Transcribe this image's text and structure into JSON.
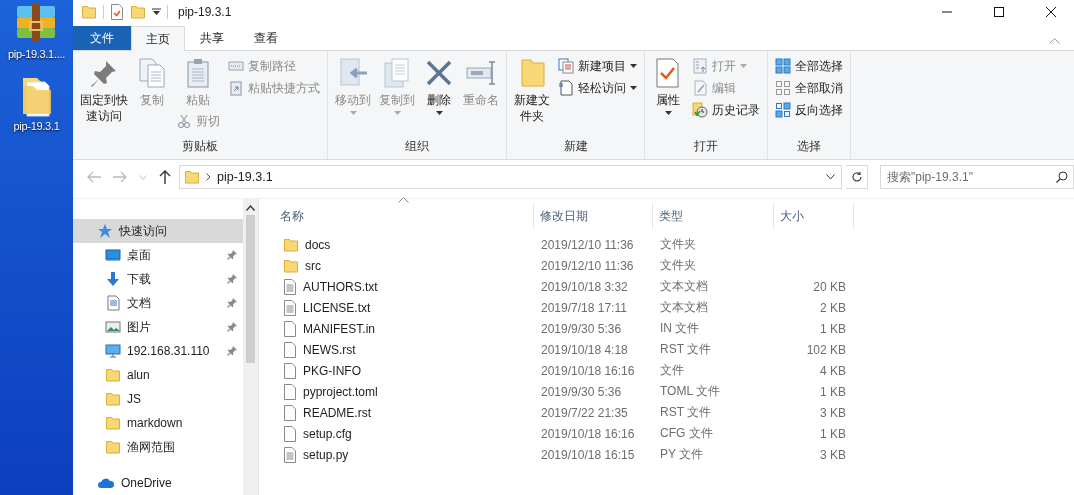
{
  "desktop": {
    "icons": [
      {
        "kind": "archive",
        "label": "pip-19.3.1...."
      },
      {
        "kind": "folder",
        "label": "pip-19.3.1"
      }
    ]
  },
  "window": {
    "title": "pip-19.3.1"
  },
  "ribbon": {
    "tabs": [
      {
        "label": "文件",
        "kind": "file",
        "selected": false
      },
      {
        "label": "主页",
        "kind": "tab",
        "selected": true
      },
      {
        "label": "共享",
        "kind": "tab",
        "selected": false
      },
      {
        "label": "查看",
        "kind": "tab",
        "selected": false
      }
    ],
    "groups": [
      {
        "label": "剪贴板",
        "columns": [
          [
            {
              "kind": "large",
              "label": "固定到快速访问",
              "disabled": false,
              "dropdown": false
            }
          ],
          [
            {
              "kind": "large",
              "label": "复制",
              "disabled": true,
              "dropdown": false
            }
          ],
          [
            {
              "kind": "large",
              "label": "粘贴",
              "disabled": true,
              "dropdown": false
            },
            {
              "kind": "small",
              "label": "剪切",
              "disabled": true,
              "dropdown": false
            }
          ],
          [
            {
              "kind": "small",
              "label": "复制路径",
              "disabled": true,
              "dropdown": false
            },
            {
              "kind": "small",
              "label": "粘贴快捷方式",
              "disabled": true,
              "dropdown": false
            }
          ]
        ]
      },
      {
        "label": "组织",
        "columns": [
          [
            {
              "kind": "large",
              "label": "移动到",
              "disabled": true,
              "dropdown": true
            }
          ],
          [
            {
              "kind": "large",
              "label": "复制到",
              "disabled": true,
              "dropdown": true
            }
          ],
          [
            {
              "kind": "large",
              "label": "删除",
              "disabled": false,
              "dropdown": true
            }
          ],
          [
            {
              "kind": "large",
              "label": "重命名",
              "disabled": true,
              "dropdown": false
            }
          ]
        ]
      },
      {
        "label": "新建",
        "columns": [
          [
            {
              "kind": "large",
              "label": "新建文件夹",
              "disabled": false,
              "dropdown": false
            }
          ],
          [
            {
              "kind": "small",
              "label": "新建项目",
              "disabled": false,
              "dropdown": true
            },
            {
              "kind": "small",
              "label": "轻松访问",
              "disabled": false,
              "dropdown": true
            }
          ]
        ]
      },
      {
        "label": "打开",
        "columns": [
          [
            {
              "kind": "large",
              "label": "属性",
              "disabled": false,
              "dropdown": true
            }
          ],
          [
            {
              "kind": "small",
              "label": "打开",
              "disabled": true,
              "dropdown": true
            },
            {
              "kind": "small",
              "label": "编辑",
              "disabled": true,
              "dropdown": false
            },
            {
              "kind": "small",
              "label": "历史记录",
              "disabled": false,
              "dropdown": false
            }
          ]
        ]
      },
      {
        "label": "选择",
        "columns": [
          [
            {
              "kind": "small",
              "label": "全部选择",
              "disabled": false,
              "dropdown": false
            },
            {
              "kind": "small",
              "label": "全部取消",
              "disabled": false,
              "dropdown": false
            },
            {
              "kind": "small",
              "label": "反向选择",
              "disabled": false,
              "dropdown": false
            }
          ]
        ]
      }
    ]
  },
  "address_bar": {
    "path": "pip-19.3.1"
  },
  "search": {
    "placeholder": "搜索\"pip-19.3.1\""
  },
  "navigation": {
    "items": [
      {
        "label": "快速访问",
        "selected": true,
        "children": [
          {
            "label": "桌面",
            "pinned": true
          },
          {
            "label": "下载",
            "pinned": true
          },
          {
            "label": "文档",
            "pinned": true
          },
          {
            "label": "图片",
            "pinned": true
          },
          {
            "label": "192.168.31.110",
            "pinned": true
          },
          {
            "label": "alun",
            "pinned": false
          },
          {
            "label": "JS",
            "pinned": false
          },
          {
            "label": "markdown",
            "pinned": false
          },
          {
            "label": "渔网范围",
            "pinned": false
          }
        ]
      },
      {
        "label": "OneDrive",
        "selected": false
      }
    ]
  },
  "file_list": {
    "columns": [
      {
        "label": "名称",
        "sorted": true
      },
      {
        "label": "修改日期",
        "sorted": false
      },
      {
        "label": "类型",
        "sorted": false
      },
      {
        "label": "大小",
        "sorted": false
      }
    ],
    "rows": [
      {
        "kind": "folder",
        "name": "docs",
        "modified": "2019/12/10 11:36",
        "type": "文件夹"
      },
      {
        "kind": "folder",
        "name": "src",
        "modified": "2019/12/10 11:36",
        "type": "文件夹"
      },
      {
        "kind": "text",
        "name": "AUTHORS.txt",
        "modified": "2019/10/18 3:32",
        "type": "文本文档",
        "size": "20 KB"
      },
      {
        "kind": "text",
        "name": "LICENSE.txt",
        "modified": "2019/7/18 17:11",
        "type": "文本文档",
        "size": "2 KB"
      },
      {
        "kind": "file",
        "name": "MANIFEST.in",
        "modified": "2019/9/30 5:36",
        "type": "IN 文件",
        "size": "1 KB"
      },
      {
        "kind": "file",
        "name": "NEWS.rst",
        "modified": "2019/10/18 4:18",
        "type": "RST 文件",
        "size": "102 KB"
      },
      {
        "kind": "file",
        "name": "PKG-INFO",
        "modified": "2019/10/18 16:16",
        "type": "文件",
        "size": "4 KB"
      },
      {
        "kind": "file",
        "name": "pyproject.toml",
        "modified": "2019/9/30 5:36",
        "type": "TOML 文件",
        "size": "1 KB"
      },
      {
        "kind": "file",
        "name": "README.rst",
        "modified": "2019/7/22 21:35",
        "type": "RST 文件",
        "size": "3 KB"
      },
      {
        "kind": "file",
        "name": "setup.cfg",
        "modified": "2019/10/18 16:16",
        "type": "CFG 文件",
        "size": "1 KB"
      },
      {
        "kind": "text",
        "name": "setup.py",
        "modified": "2019/10/18 16:15",
        "type": "PY 文件",
        "size": "3 KB"
      }
    ]
  }
}
